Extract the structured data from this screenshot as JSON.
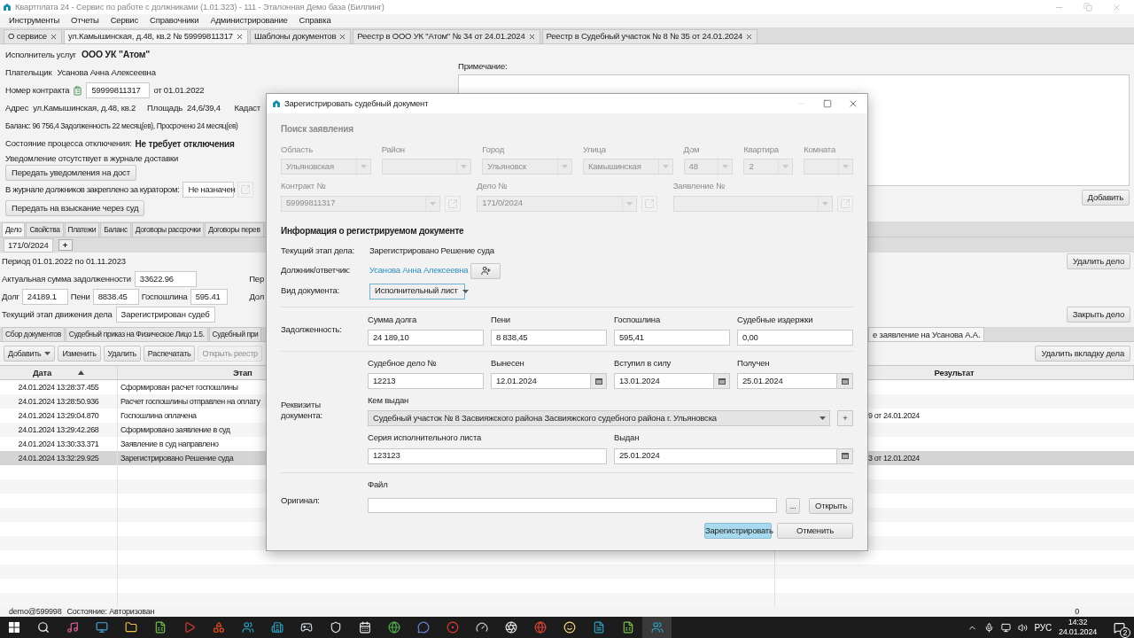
{
  "window": {
    "title": "Квартплата 24 - Сервис по работе с должниками (1.01.323) - 111 - Эталонная Демо база (Биллинг)"
  },
  "menu": [
    "Инструменты",
    "Отчеты",
    "Сервис",
    "Справочники",
    "Администрирование",
    "Справка"
  ],
  "doc_tabs": [
    {
      "label": "О сервисе",
      "selected": false
    },
    {
      "label": "ул.Камышинская, д.48, кв.2 № 59999811317",
      "selected": true
    },
    {
      "label": "Шаблоны документов",
      "selected": false
    },
    {
      "label": "Реестр в ООО УК \"Атом\" № 34 от 24.01.2024",
      "selected": false
    },
    {
      "label": "Реестр в Судебный участок № 8 № 35 от 24.01.2024",
      "selected": false
    }
  ],
  "account": {
    "provider_label": "Исполнитель услуг",
    "provider": "ООО УК \"Атом\"",
    "payer_label": "Плательщик",
    "payer": "Усанова Анна Алексеевна",
    "contract_label": "Номер контракта",
    "contract": "59999811317",
    "contract_date": "от 01.01.2022",
    "address_label": "Адрес",
    "address": "ул.Камышинская, д.48, кв.2",
    "area_label": "Площадь",
    "area": "24,6/39,4",
    "cadastre_label": "Кадаст",
    "balance": "Баланс: 96 756,4 Задолженность 22  месяц(ев), Просрочено 24 месяц(ев)",
    "disconnect_label": "Состояние процесса отключения:",
    "disconnect": "Не требует отключения",
    "notice_label": "Уведомление отсутствует в журнале доставки",
    "notice_button": "Передать уведомления на дост",
    "curator_label": "В журнале должников закреплено за куратором:",
    "curator": "Не назначен",
    "court_button": "Передать на взыскание через суд"
  },
  "note": {
    "label": "Примечание:",
    "add_button": "Добавить"
  },
  "case_tabs": [
    {
      "label": "Дело",
      "selected": true
    },
    {
      "label": "Свойства",
      "selected": false
    },
    {
      "label": "Платежи",
      "selected": false
    },
    {
      "label": "Баланс",
      "selected": false
    },
    {
      "label": "Договоры рассрочки",
      "selected": false
    },
    {
      "label": "Договоры перев",
      "selected": false
    }
  ],
  "case": {
    "number_tab": "171/0/2024",
    "add_tab": "+",
    "period": "Период 01.01.2022 по 01.11.2023",
    "debt_label": "Актуальная сумма задолженности",
    "debt": "33622.96",
    "cut_label_1": "Пер",
    "principal_label": "Долг",
    "principal": "24189.1",
    "penalty_label": "Пени",
    "penalty": "8838.45",
    "fee_label": "Госпошлина",
    "fee": "595.41",
    "cut_label_2": "Дол",
    "stage_label": "Текущий этап движения дела",
    "stage": "Зарегистрирован судеб",
    "delete_button": "Удалить дело",
    "close_button": "Закрыть дело"
  },
  "stage_tabs": [
    {
      "label": "Сбор документов",
      "selected": false
    },
    {
      "label": "Судебный приказ на Физическое Лицо 1.5.",
      "selected": false
    },
    {
      "label": "Судебный при",
      "selected": false
    }
  ],
  "stage_tab_right": {
    "label": "е заявление на Усанова А.А.",
    "selected": true
  },
  "toolbar": [
    {
      "label": "Добавить",
      "dropdown": true,
      "disabled": false
    },
    {
      "label": "Изменить",
      "dropdown": false,
      "disabled": false
    },
    {
      "label": "Удалить",
      "dropdown": false,
      "disabled": false
    },
    {
      "label": "Распечатать",
      "dropdown": false,
      "disabled": false
    },
    {
      "label": "Открыть реестр",
      "dropdown": false,
      "disabled": true
    }
  ],
  "delete_tab_button": "Удалить вкладку дела",
  "history": {
    "columns": [
      {
        "label": "Дата",
        "sorted": true
      },
      {
        "label": "Этап",
        "sorted": false
      },
      {
        "label": "Результат",
        "sorted": false
      }
    ],
    "rows": [
      {
        "date": "24.01.2024 13:28:37.455",
        "stage": "Сформирован расчет госпошлины",
        "selected": false
      },
      {
        "date": "24.01.2024 13:28:50.936",
        "stage": "Расчет госпошлины отправлен на оплату",
        "selected": false
      },
      {
        "date": "24.01.2024 13:29:04.870",
        "stage": "Госпошлина оплачена",
        "result": "9 от 24.01.2024",
        "selected": false
      },
      {
        "date": "24.01.2024 13:29:42.268",
        "stage": "Сформировано заявление в суд",
        "selected": false
      },
      {
        "date": "24.01.2024 13:30:33.371",
        "stage": "Заявление в суд направлено",
        "selected": false
      },
      {
        "date": "24.01.2024 13:32:29.925",
        "stage": "Зарегистрировано Решение суда",
        "result": "3 от 12.01.2024",
        "selected": true
      }
    ]
  },
  "status_bar": {
    "user": "demo@599998",
    "state": "Состояние: Авторизован",
    "counter": "0"
  },
  "taskbar": {
    "language": "РУС",
    "time": "14:32",
    "date": "24.01.2024",
    "notifications": "2"
  },
  "dialog": {
    "title": "Зарегистрировать судебный документ",
    "search": {
      "title": "Поиск заявления",
      "disabled": true,
      "address_fields": [
        {
          "label": "Область",
          "value": "Ульяновская"
        },
        {
          "label": "Район"
        },
        {
          "label": "Город",
          "value": "Ульяновск"
        },
        {
          "label": "Улица",
          "value": "Камышинская"
        },
        {
          "label": "Дом",
          "value": "48"
        },
        {
          "label": "Квартира",
          "value": "2"
        },
        {
          "label": "Комната"
        }
      ],
      "link_fields": [
        {
          "label": "Контракт №",
          "value": "59999811317"
        },
        {
          "label": "Дело №",
          "value": "171/0/2024"
        },
        {
          "label": "Заявление №"
        }
      ]
    },
    "info_title": "Информация о регистрируемом документе",
    "stage_label": "Текущий этап дела:",
    "stage": "Зарегистрировано Решение суда",
    "debtor_label": "Должник/ответчик:",
    "debtor": "Усанова Анна Алексеевна",
    "doc_type_label": "Вид документа:",
    "doc_type": "Исполнительный лист",
    "doc_type_focused": true,
    "debt": {
      "label": "Задолженность:",
      "fields": [
        {
          "label": "Сумма долга",
          "value": "24 189,10"
        },
        {
          "label": "Пени",
          "value": "8 838,45"
        },
        {
          "label": "Госпошлина",
          "value": "595,41"
        },
        {
          "label": "Судебные издержки",
          "value": "0,00"
        }
      ]
    },
    "details": {
      "label": "Реквизиты документа:",
      "row1": [
        {
          "label": "Судебное дело №",
          "value": "12213",
          "kind": "text"
        },
        {
          "label": "Вынесен",
          "value": "12.01.2024",
          "kind": "date"
        },
        {
          "label": "Вступил в силу",
          "value": "13.01.2024",
          "kind": "date"
        },
        {
          "label": "Получен",
          "value": "25.01.2024",
          "kind": "date"
        }
      ],
      "issuer_label": "Кем выдан",
      "issuer": "Судебный участок № 8 Засвияжского района Засвияжского судебного района г. Ульяновска",
      "issuer_add": "+",
      "row3": [
        {
          "label": "Серия исполнительного листа",
          "value": "123123",
          "kind": "text"
        },
        {
          "label": "Выдан",
          "value": "25.01.2024",
          "kind": "date"
        }
      ]
    },
    "original": {
      "label": "Оригинал:",
      "file_label": "Файл",
      "browse": "...",
      "open": "Открыть"
    },
    "buttons": [
      {
        "label": "Зарегистрировать",
        "primary": true
      },
      {
        "label": "Отменить",
        "primary": false
      }
    ]
  }
}
